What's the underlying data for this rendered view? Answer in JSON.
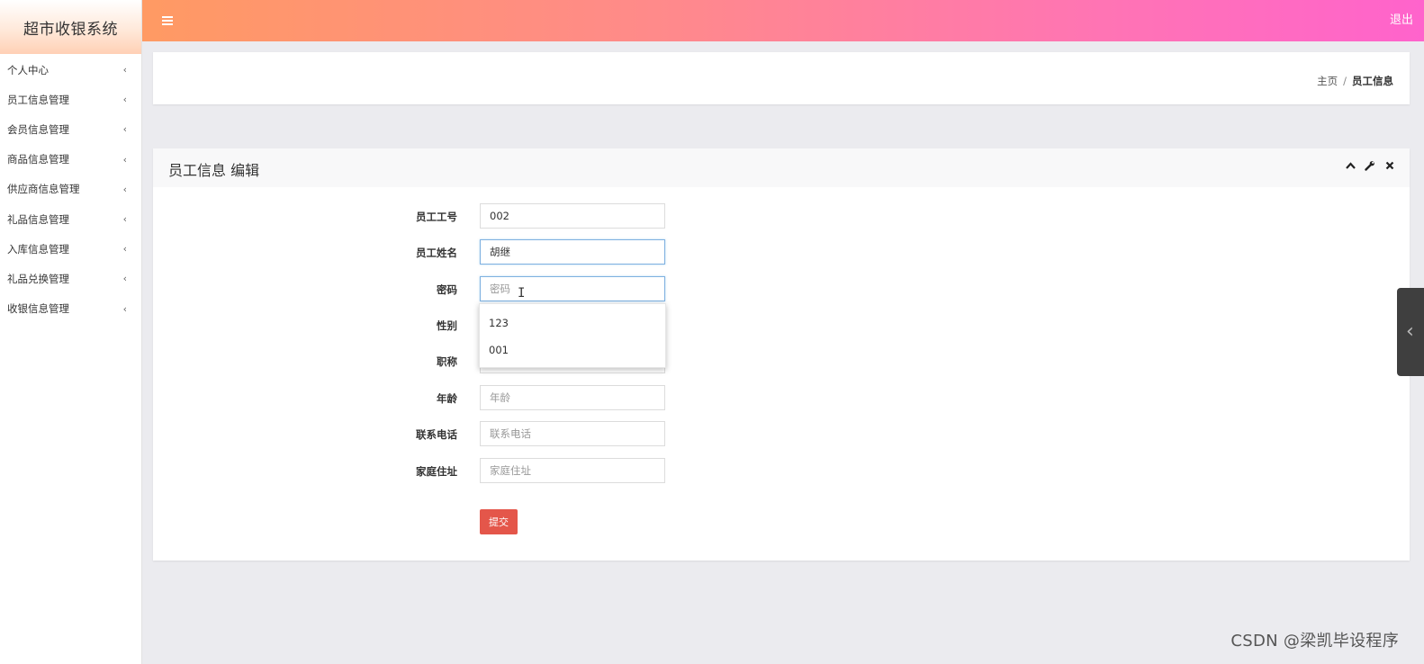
{
  "app": {
    "title": "超市收银系统"
  },
  "sidebar": {
    "items": [
      {
        "label": "个人中心"
      },
      {
        "label": "员工信息管理"
      },
      {
        "label": "会员信息管理"
      },
      {
        "label": "商品信息管理"
      },
      {
        "label": "供应商信息管理"
      },
      {
        "label": "礼品信息管理"
      },
      {
        "label": "入库信息管理"
      },
      {
        "label": "礼品兑换管理"
      },
      {
        "label": "收银信息管理"
      }
    ],
    "chevron": "‹"
  },
  "topbar": {
    "logout_label": "退出"
  },
  "breadcrumb": {
    "home": "主页",
    "separator": "/",
    "current": "员工信息"
  },
  "panel": {
    "title": "员工信息 编辑"
  },
  "form": {
    "fields": [
      {
        "label": "员工工号",
        "value": "002",
        "placeholder": ""
      },
      {
        "label": "员工姓名",
        "value": "胡继",
        "placeholder": ""
      },
      {
        "label": "密码",
        "value": "",
        "placeholder": "密码"
      },
      {
        "label": "性别",
        "value": "",
        "placeholder": ""
      },
      {
        "label": "职称",
        "value": "",
        "placeholder": ""
      },
      {
        "label": "年龄",
        "value": "",
        "placeholder": "年龄"
      },
      {
        "label": "联系电话",
        "value": "",
        "placeholder": "联系电话"
      },
      {
        "label": "家庭住址",
        "value": "",
        "placeholder": "家庭住址"
      }
    ],
    "autocomplete_options": [
      "123",
      "001"
    ],
    "submit_label": "提交"
  },
  "watermark": "CSDN @梁凯毕设程序",
  "colors": {
    "topbar_start": "#ff9a63",
    "topbar_end": "#ff63cc",
    "submit": "#e4564a"
  }
}
